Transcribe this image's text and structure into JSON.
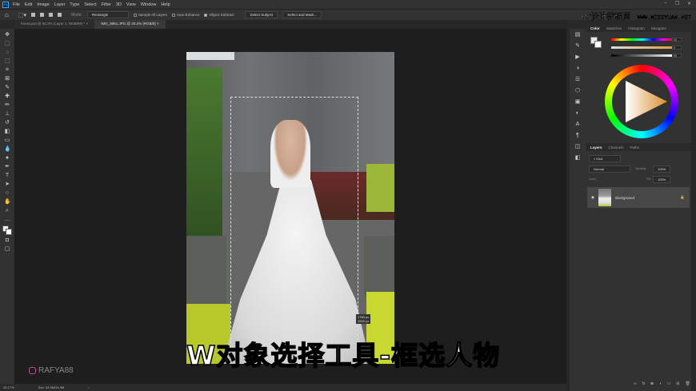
{
  "app": {
    "logo": "Ps",
    "menu": [
      "File",
      "Edit",
      "Image",
      "Layer",
      "Type",
      "Select",
      "Filter",
      "3D",
      "View",
      "Window",
      "Help"
    ],
    "window_controls": [
      "–",
      "❐",
      "✕"
    ]
  },
  "options": {
    "mode_label": "Mode:",
    "mode_value": "Rectangle",
    "sample_all_layers": "Sample All Layers",
    "auto_enhance": "Auto-Enhance",
    "object_subtract": "Object Subtract",
    "select_subject": "Select Subject",
    "select_and_mask": "Select and Mask..."
  },
  "tabs": [
    {
      "label": "forest.psd @ 50.3% (Layer 1, RGB/8#) *",
      "active": false
    },
    {
      "label": "IMG_9951.JPG @ 20.2% (RGB/8)",
      "active": true
    }
  ],
  "color_panel": {
    "tabs": [
      "Color",
      "Swatches",
      "Histogram",
      "Navigator"
    ],
    "values": [
      "30",
      "5",
      "85"
    ],
    "unit": "%"
  },
  "layers_panel": {
    "tabs": [
      "Layers",
      "Channels",
      "Paths"
    ],
    "filter": "Kind",
    "blend": "Normal",
    "opacity_label": "Opacity:",
    "opacity": "100%",
    "lock_label": "Lock:",
    "fill_label": "Fill:",
    "fill": "100%",
    "layer_name": "Background"
  },
  "status": {
    "zoom": "20.17%",
    "doc": "Doc: 34.9M/34.9M"
  },
  "selection_size": [
    "1780 px",
    "2605 px"
  ],
  "subtitle": "W对象选择工具-框选人物",
  "watermark": {
    "site": "PS设计教程网",
    "url": "WWW.MISSYUAN.NET"
  },
  "instagram": "RAFYA88"
}
